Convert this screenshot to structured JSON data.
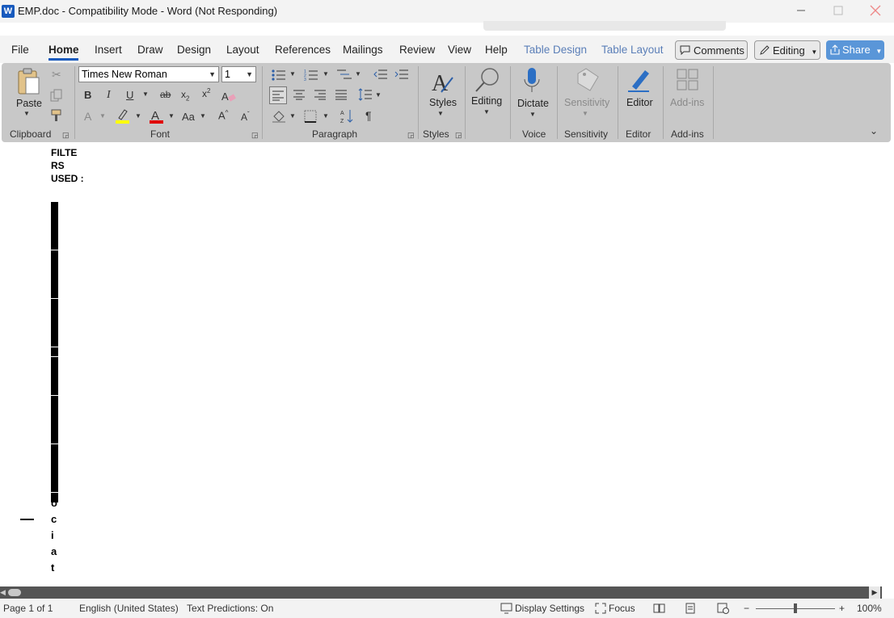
{
  "window": {
    "title": "EMP.doc  -  Compatibility Mode - Word (Not Responding)",
    "app_icon_letter": "W",
    "minimize_icon": "minimize-icon",
    "maximize_icon": "maximize-icon",
    "close_icon": "close-icon"
  },
  "tabs": [
    "File",
    "Home",
    "Insert",
    "Draw",
    "Design",
    "Layout",
    "References",
    "Mailings",
    "Review",
    "View",
    "Help",
    "Table Design",
    "Table Layout"
  ],
  "active_tab": "Home",
  "top_buttons": {
    "comments": "Comments",
    "editing": "Editing",
    "share": "Share"
  },
  "ribbon": {
    "clipboard": {
      "label": "Clipboard",
      "paste": "Paste"
    },
    "font": {
      "label": "Font",
      "font_name": "Times New Roman",
      "font_size": "1",
      "change_case": "Aa"
    },
    "paragraph": {
      "label": "Paragraph"
    },
    "styles": {
      "label": "Styles",
      "styles_button": "Styles"
    },
    "editing": {
      "button": "Editing"
    },
    "voice": {
      "label": "Voice",
      "dictate": "Dictate"
    },
    "sensitivity": {
      "label": "Sensitivity",
      "button": "Sensitivity"
    },
    "editor": {
      "label": "Editor",
      "button": "Editor"
    },
    "addins": {
      "label": "Add-ins",
      "button": "Add-ins"
    }
  },
  "document": {
    "filters_label": "FILTE\nRS\nUSED :",
    "vertical_letters": [
      "o",
      "c",
      "i",
      "a",
      "t"
    ]
  },
  "status_bar": {
    "page": "Page 1 of 1",
    "language": "English (United States)",
    "text_predictions": "Text Predictions: On",
    "display_settings": "Display Settings",
    "focus": "Focus",
    "zoom_level": "100%",
    "zoom_minus": "−",
    "zoom_plus": "+"
  },
  "colors": {
    "accent": "#185abd",
    "highlight_color": "#ffff00",
    "font_color": "#e00000",
    "ribbon_bg": "#c8c8c8"
  }
}
